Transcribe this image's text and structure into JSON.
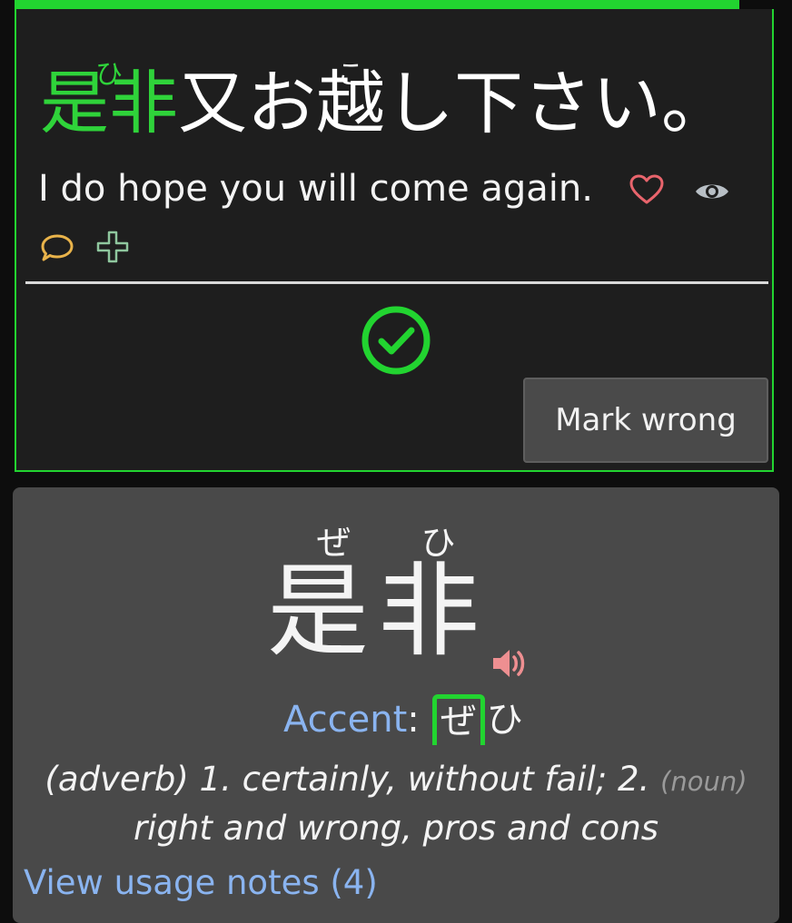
{
  "review": {
    "sentence": {
      "word1": {
        "kanji": "是非",
        "furigana": "ひ"
      },
      "part2": "又お",
      "word2": {
        "kanji": "越",
        "furigana": "こ"
      },
      "part3": "し下さい。"
    },
    "translation": "I do hope you will come again.",
    "mark_wrong_label": "Mark wrong"
  },
  "word_details": {
    "furigana": [
      "ぜ",
      "ひ"
    ],
    "word": "是非",
    "accent_label": "Accent",
    "accent_colon": ":",
    "accent_high": "ぜ",
    "accent_low": "ひ",
    "definition": {
      "pos1": "(adverb)",
      "sense1": "1. certainly, without fail;",
      "sense2_num": "2.",
      "pos2": "(noun)",
      "sense2": "right and wrong, pros and cons"
    },
    "usage_notes_link": "View usage notes (4)"
  },
  "icons": [
    "heart-icon",
    "eye-icon",
    "comment-icon",
    "plus-icon",
    "check-circle-icon",
    "speaker-icon"
  ],
  "colors": {
    "success": "#22d430",
    "heart": "#e8646c",
    "comment": "#e9b34a",
    "plus": "#8fc79e",
    "link": "#8ab4f0",
    "speaker": "#ee8f91"
  }
}
